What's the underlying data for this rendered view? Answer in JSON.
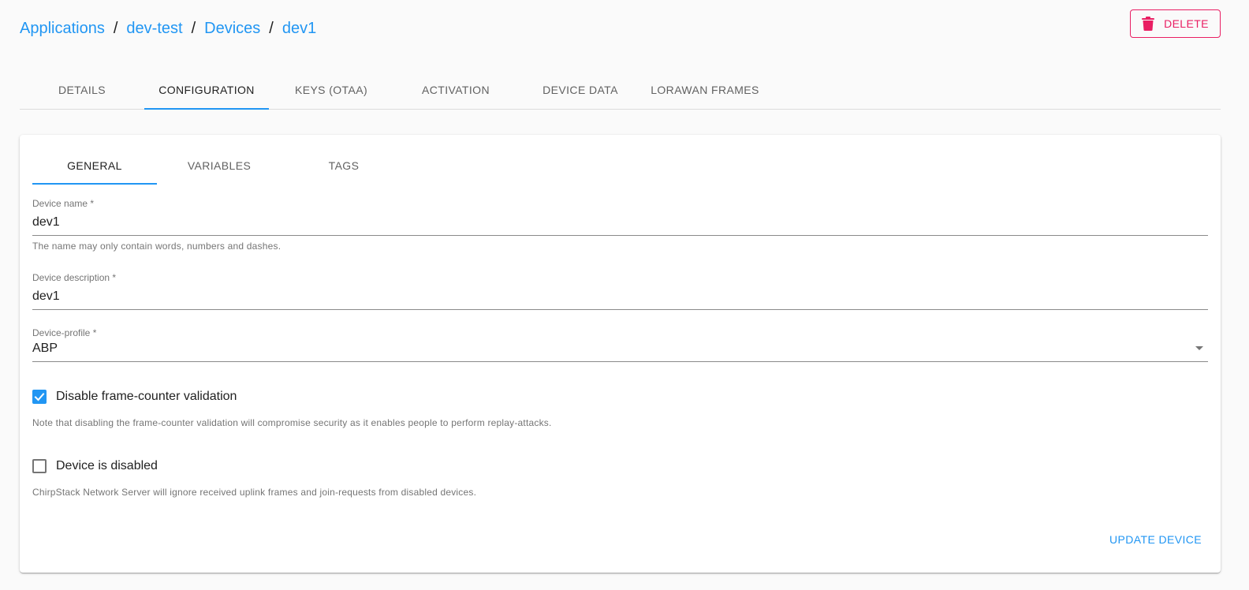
{
  "breadcrumb": {
    "items": [
      "Applications",
      "dev-test",
      "Devices",
      "dev1"
    ],
    "separator": "/"
  },
  "header": {
    "delete_label": "DELETE"
  },
  "tabs": [
    "DETAILS",
    "CONFIGURATION",
    "KEYS (OTAA)",
    "ACTIVATION",
    "DEVICE DATA",
    "LORAWAN FRAMES"
  ],
  "active_tab": "CONFIGURATION",
  "subtabs": [
    "GENERAL",
    "VARIABLES",
    "TAGS"
  ],
  "active_subtab": "GENERAL",
  "form": {
    "device_name": {
      "label": "Device name *",
      "value": "dev1",
      "helper": "The name may only contain words, numbers and dashes."
    },
    "device_description": {
      "label": "Device description *",
      "value": "dev1"
    },
    "device_profile": {
      "label": "Device-profile *",
      "value": "ABP"
    },
    "disable_fcnt": {
      "label": "Disable frame-counter validation",
      "checked": true,
      "note": "Note that disabling the frame-counter validation will compromise security as it enables people to perform replay-attacks."
    },
    "device_disabled": {
      "label": "Device is disabled",
      "checked": false,
      "note": "ChirpStack Network Server will ignore received uplink frames and join-requests from disabled devices."
    },
    "update_label": "UPDATE DEVICE"
  },
  "colors": {
    "accent": "#2196f3",
    "danger": "#e91e63"
  },
  "icons": {
    "delete": "trash-icon",
    "select": "dropdown-arrow-icon",
    "check": "check-icon"
  }
}
